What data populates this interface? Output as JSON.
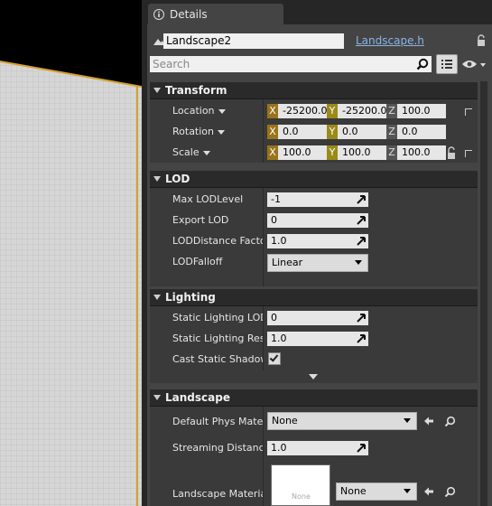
{
  "viewport": {
    "ground_color": "#d8d8d8",
    "edge_color": "#d4a030"
  },
  "tab": {
    "title": "Details",
    "icon": "info-icon"
  },
  "header": {
    "actor_name": "Landscape2",
    "class_link": "Landscape.h",
    "search_placeholder": "Search"
  },
  "categories": {
    "transform": {
      "title": "Transform",
      "location": {
        "label": "Location",
        "x": "-25200.0",
        "y": "-25200.0",
        "z": "100.0"
      },
      "rotation": {
        "label": "Rotation",
        "x": "0.0",
        "y": "0.0",
        "z": "0.0"
      },
      "scale": {
        "label": "Scale",
        "x": "100.0",
        "y": "100.0",
        "z": "100.0"
      }
    },
    "lod": {
      "title": "LOD",
      "max_lod_level": {
        "label": "Max LODLevel",
        "value": "-1"
      },
      "export_lod": {
        "label": "Export LOD",
        "value": "0"
      },
      "lod_distance_factor": {
        "label": "LODDistance Factor",
        "value": "1.0"
      },
      "lod_falloff": {
        "label": "LODFalloff",
        "value": "Linear"
      }
    },
    "lighting": {
      "title": "Lighting",
      "static_lighting_lod": {
        "label": "Static Lighting LOD",
        "value": "0"
      },
      "static_lighting_resolution": {
        "label": "Static Lighting Resolution",
        "value": "1.0"
      },
      "cast_static_shadow": {
        "label": "Cast Static Shadow",
        "checked": true
      }
    },
    "landscape": {
      "title": "Landscape",
      "default_phys_material": {
        "label": "Default Phys Material",
        "value": "None"
      },
      "streaming_distance": {
        "label": "Streaming Distance Multiplier",
        "value": "1.0"
      },
      "landscape_material": {
        "label": "Landscape Material",
        "value": "None",
        "thumb_label": "None"
      }
    }
  },
  "axis_labels": {
    "x": "X",
    "y": "Y",
    "z": "Z"
  }
}
